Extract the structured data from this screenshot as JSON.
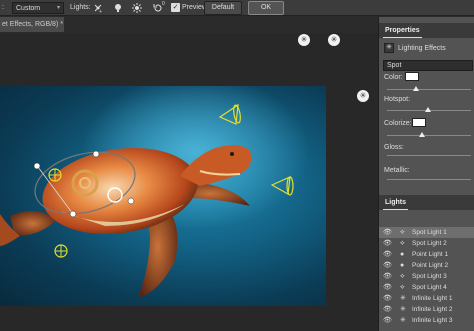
{
  "options_bar": {
    "presets_label": ":",
    "preset_value": "Custom",
    "lights_label": "Lights:",
    "rotate_badge": "0",
    "preview_label": "Preview",
    "preview_check": "✓",
    "default_label": "Default",
    "ok_label": "OK"
  },
  "document_tab": {
    "title": "et Effects, RGB/8) *"
  },
  "properties": {
    "tab": "Properties",
    "header": "Lighting Effects",
    "light_type": "Spot",
    "color_label": "Color:",
    "hotspot_label": "Hotspot:",
    "colorize_label": "Colorize:",
    "gloss_label": "Gloss:",
    "metallic_label": "Metallic:"
  },
  "lights_panel": {
    "tab": "Lights",
    "items": [
      {
        "type_icon": "spot-light-icon",
        "name": "Spot Light 1",
        "selected": true
      },
      {
        "type_icon": "spot-light-icon",
        "name": "Spot Light 2",
        "selected": false
      },
      {
        "type_icon": "point-light-icon",
        "name": "Point Light 1",
        "selected": false
      },
      {
        "type_icon": "point-light-icon",
        "name": "Point Light 2",
        "selected": false
      },
      {
        "type_icon": "spot-light-icon",
        "name": "Spot Light 3",
        "selected": false
      },
      {
        "type_icon": "spot-light-icon",
        "name": "Spot Light 4",
        "selected": false
      },
      {
        "type_icon": "infinite-light-icon",
        "name": "Infinite Light 1",
        "selected": false
      },
      {
        "type_icon": "infinite-light-icon",
        "name": "Infinite Light 2",
        "selected": false
      },
      {
        "type_icon": "infinite-light-icon",
        "name": "Infinite Light 3",
        "selected": false
      }
    ]
  },
  "colors": {
    "accent_light_yellow": "#e6e02a",
    "panel_bg": "#535353",
    "toolbar_bg": "#3c3c3c"
  }
}
